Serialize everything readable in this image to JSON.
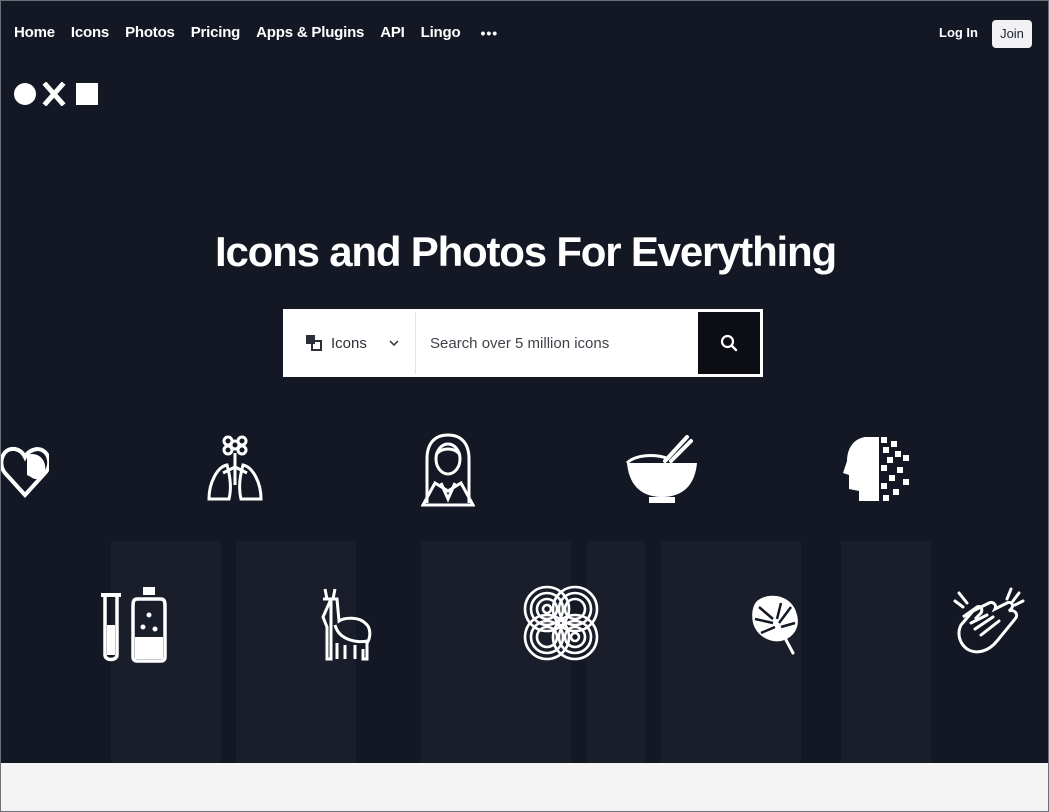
{
  "nav": {
    "links": [
      "Home",
      "Icons",
      "Photos",
      "Pricing",
      "Apps & Plugins",
      "API",
      "Lingo"
    ],
    "more_label": "•••",
    "login_label": "Log In",
    "join_label": "Join"
  },
  "logo": {
    "icon": "circle-x-square-logo"
  },
  "hero": {
    "headline": "Icons and Photos For Everything",
    "background_color": "#141824"
  },
  "search": {
    "type_label": "Icons",
    "placeholder": "Search over 5 million icons",
    "icons": {
      "type": "noun-project-icon",
      "chevron": "chevron-down-icon",
      "submit": "search-icon"
    }
  },
  "showcase_icons": [
    "heart-face-icon",
    "flower-lungs-icon",
    "woman-portrait-icon",
    "bowl-chopsticks-icon",
    "pixel-head-icon",
    "test-tube-bottle-icon",
    "llama-icon",
    "knot-pattern-icon",
    "monstera-leaf-icon",
    "clapping-hands-icon"
  ]
}
